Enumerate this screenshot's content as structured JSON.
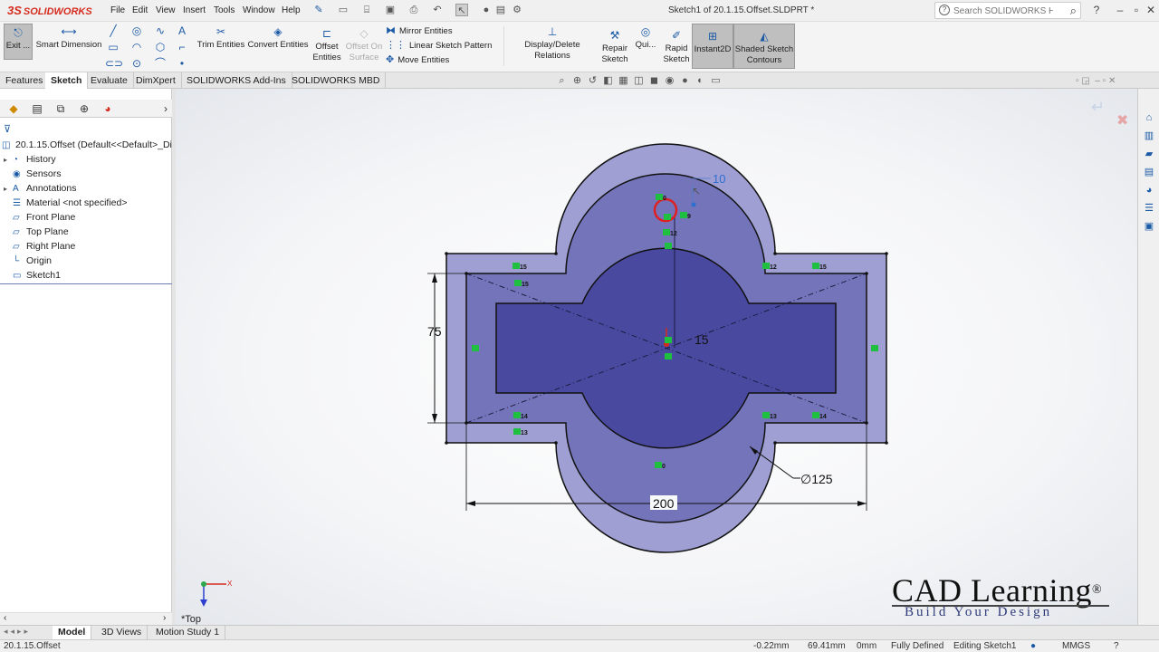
{
  "app": {
    "brand": "SOLIDWORKS",
    "ds_mark": "3S"
  },
  "menu": [
    "File",
    "Edit",
    "View",
    "Insert",
    "Tools",
    "Window",
    "Help"
  ],
  "window": {
    "title": "Sketch1 of 20.1.15.Offset.SLDPRT *"
  },
  "search": {
    "placeholder": "Search SOLIDWORKS Help"
  },
  "toolbar": {
    "exit_sketch": "Exit ...",
    "smart_dimension": "Smart Dimension",
    "trim_entities": "Trim Entities",
    "convert_entities": "Convert Entities",
    "offset_entities_1": "Offset",
    "offset_entities_2": "Entities",
    "offset_surface_1": "Offset On",
    "offset_surface_2": "Surface",
    "mirror_entities": "Mirror Entities",
    "linear_pattern": "Linear Sketch Pattern",
    "move_entities": "Move Entities",
    "display_relations": "Display/Delete Relations",
    "repair_1": "Repair",
    "repair_2": "Sketch",
    "quick_snaps": "Qui...",
    "rapid_1": "Rapid",
    "rapid_2": "Sketch",
    "instant2d": "Instant2D",
    "shaded_1": "Shaded Sketch",
    "shaded_2": "Contours"
  },
  "tabs": [
    {
      "label": "Features",
      "active": false
    },
    {
      "label": "Sketch",
      "active": true
    },
    {
      "label": "Evaluate",
      "active": false
    },
    {
      "label": "DimXpert",
      "active": false
    },
    {
      "label": "SOLIDWORKS Add-Ins",
      "active": false
    },
    {
      "label": "SOLIDWORKS MBD",
      "active": false
    }
  ],
  "feature_tree": {
    "root": "20.1.15.Offset  (Default<<Default>_Disp",
    "items": [
      {
        "label": "History",
        "icon": "history-icon",
        "expandable": true
      },
      {
        "label": "Sensors",
        "icon": "sensors-icon",
        "expandable": false
      },
      {
        "label": "Annotations",
        "icon": "annotations-icon",
        "expandable": true
      },
      {
        "label": "Material <not specified>",
        "icon": "material-icon",
        "expandable": false
      },
      {
        "label": "Front Plane",
        "icon": "plane-icon",
        "expandable": false
      },
      {
        "label": "Top Plane",
        "icon": "plane-icon",
        "expandable": false
      },
      {
        "label": "Right Plane",
        "icon": "plane-icon",
        "expandable": false
      },
      {
        "label": "Origin",
        "icon": "origin-icon",
        "expandable": false
      },
      {
        "label": "Sketch1",
        "icon": "sketch-icon",
        "expandable": false
      }
    ]
  },
  "drawing": {
    "dim_offset": "10",
    "dim_height": "75",
    "dim_hole": "15",
    "dim_diameter": "∅125",
    "dim_width": "200",
    "relations": [
      "0",
      "9",
      "12",
      "15",
      "15",
      "12",
      "15",
      "14",
      "13",
      "13",
      "14",
      "0"
    ],
    "view_name": "*Top"
  },
  "bottom_tabs": [
    {
      "label": "Model",
      "active": true
    },
    {
      "label": "3D Views",
      "active": false
    },
    {
      "label": "Motion Study 1",
      "active": false
    }
  ],
  "status": {
    "file": "20.1.15.Offset",
    "x": "-0.22mm",
    "y": "69.41mm",
    "z": "0mm",
    "state": "Fully Defined",
    "mode": "Editing Sketch1",
    "units": "MMGS"
  },
  "watermark": {
    "title": "CAD Learning",
    "reg": "®",
    "tagline": "Build Your Design"
  },
  "colors": {
    "accent": "#1b5aa6",
    "sketch_fill": "#8a8bc9",
    "sketch_fill_inner": "#4b4aa0",
    "relation": "#1fbf3f"
  }
}
